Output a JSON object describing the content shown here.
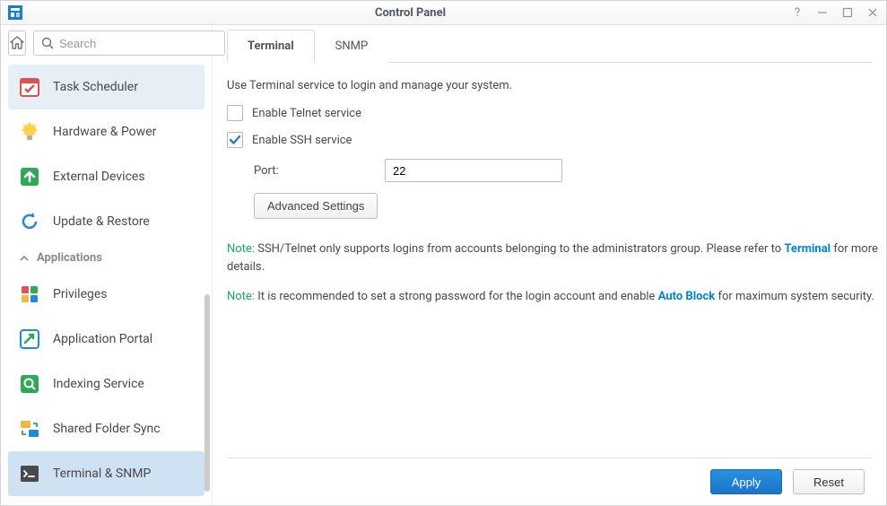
{
  "window": {
    "title": "Control Panel"
  },
  "search": {
    "placeholder": "Search"
  },
  "sidebar": {
    "items": [
      {
        "id": "task-scheduler",
        "label": "Task Scheduler"
      },
      {
        "id": "hardware-power",
        "label": "Hardware & Power"
      },
      {
        "id": "external-devices",
        "label": "External Devices"
      },
      {
        "id": "update-restore",
        "label": "Update & Restore"
      }
    ],
    "section_label": "Applications",
    "app_items": [
      {
        "id": "privileges",
        "label": "Privileges"
      },
      {
        "id": "application-portal",
        "label": "Application Portal"
      },
      {
        "id": "indexing-service",
        "label": "Indexing Service"
      },
      {
        "id": "shared-folder-sync",
        "label": "Shared Folder Sync"
      },
      {
        "id": "terminal-snmp",
        "label": "Terminal & SNMP"
      }
    ]
  },
  "tabs": {
    "terminal": "Terminal",
    "snmp": "SNMP"
  },
  "content": {
    "intro": "Use Terminal service to login and manage your system.",
    "enable_telnet": "Enable Telnet service",
    "enable_ssh": "Enable SSH service",
    "port_label": "Port:",
    "port_value": "22",
    "advanced_settings": "Advanced Settings",
    "note_label": "Note:",
    "note1_a": "SSH/Telnet only supports logins from accounts belonging to the administrators group. Please refer to ",
    "note1_link": "Terminal",
    "note1_b": " for more details.",
    "note2_a": "It is recommended to set a strong password for the login account and enable ",
    "note2_link": "Auto Block",
    "note2_b": " for maximum system security."
  },
  "footer": {
    "apply": "Apply",
    "reset": "Reset"
  }
}
